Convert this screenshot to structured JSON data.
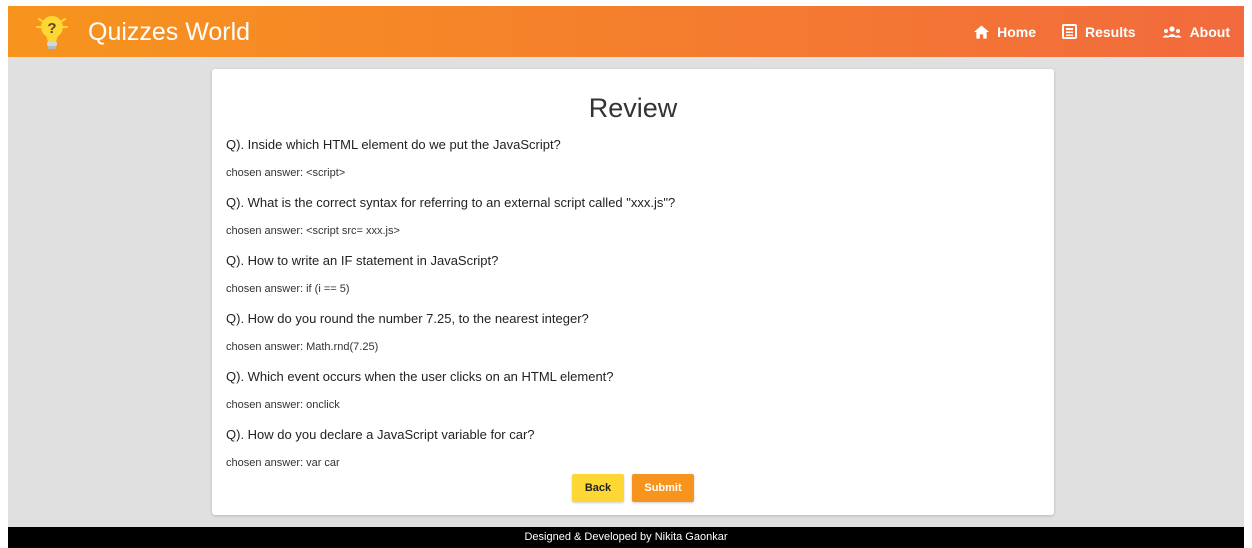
{
  "navbar": {
    "brand": "Quizzes World",
    "logo_icon": "lightbulb-question-icon",
    "items": [
      {
        "label": "Home",
        "icon": "home-icon"
      },
      {
        "label": "Results",
        "icon": "newspaper-icon"
      },
      {
        "label": "About",
        "icon": "people-icon"
      }
    ]
  },
  "review": {
    "title": "Review",
    "items": [
      {
        "question": "Q). Inside which HTML element do we put the JavaScript?",
        "answer": "chosen answer: <script>"
      },
      {
        "question": "Q). What is the correct syntax for referring to an external script called \"xxx.js\"?",
        "answer": "chosen answer: <script src= xxx.js>"
      },
      {
        "question": "Q). How to write an IF statement in JavaScript?",
        "answer": "chosen answer: if (i == 5)"
      },
      {
        "question": "Q). How do you round the number 7.25, to the nearest integer?",
        "answer": "chosen answer: Math.rnd(7.25)"
      },
      {
        "question": "Q). Which event occurs when the user clicks on an HTML element?",
        "answer": "chosen answer: onclick"
      },
      {
        "question": "Q). How do you declare a JavaScript variable for car?",
        "answer": "chosen answer: var car"
      }
    ]
  },
  "actions": {
    "back_label": "Back",
    "submit_label": "Submit"
  },
  "footer": {
    "text": "Designed & Developed by Nikita Gaonkar"
  },
  "colors": {
    "navbar_start": "#f7941d",
    "navbar_end": "#f26a3d",
    "back_button": "#fdd835",
    "submit_button": "#f7941d",
    "footer": "#000000"
  }
}
